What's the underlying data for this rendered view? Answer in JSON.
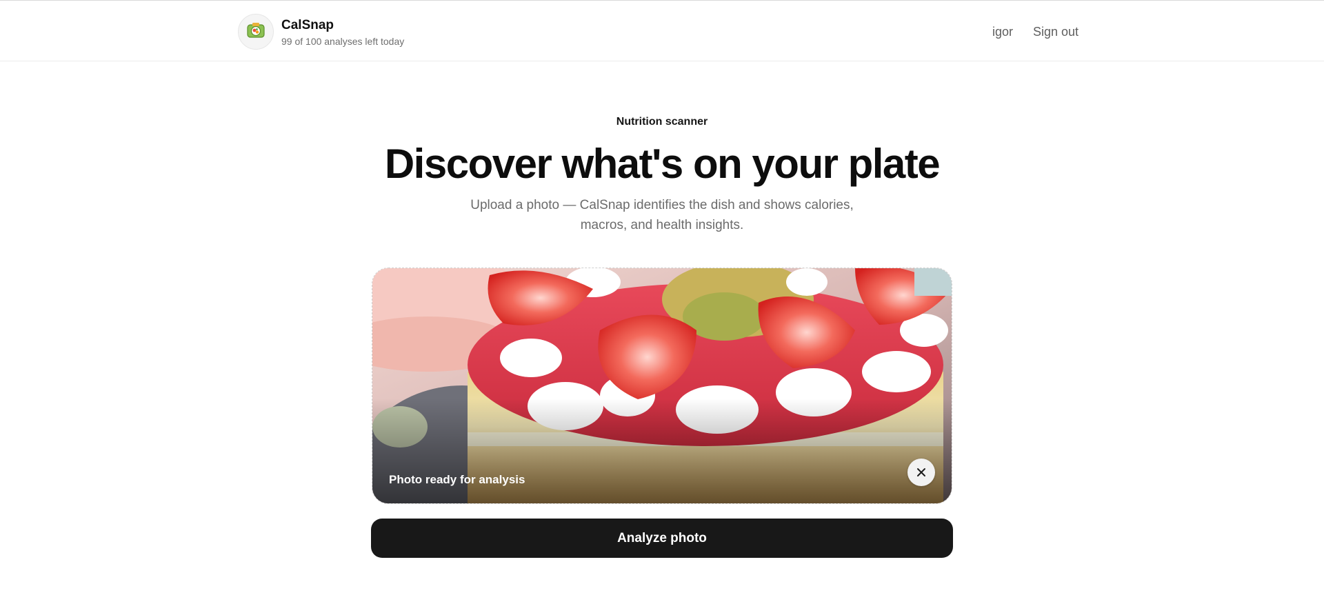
{
  "app": {
    "name": "CalSnap",
    "quota_text": "99 of 100 analyses left today",
    "logo_icon": "camera-vegetables-icon"
  },
  "nav": {
    "user": "igor",
    "sign_out": "Sign out"
  },
  "hero": {
    "eyebrow": "Nutrition scanner",
    "title": "Discover what's on your plate",
    "subtitle": "Upload a photo — CalSnap identifies the dish and shows calories, macros, and health insights."
  },
  "upload": {
    "status": "Photo ready for analysis",
    "remove_icon": "close-icon",
    "image_subject": "strawberry-cake-photo"
  },
  "actions": {
    "analyze_label": "Analyze photo"
  },
  "colors": {
    "primary_button": "#181818",
    "text_muted": "#6b6b6b"
  }
}
